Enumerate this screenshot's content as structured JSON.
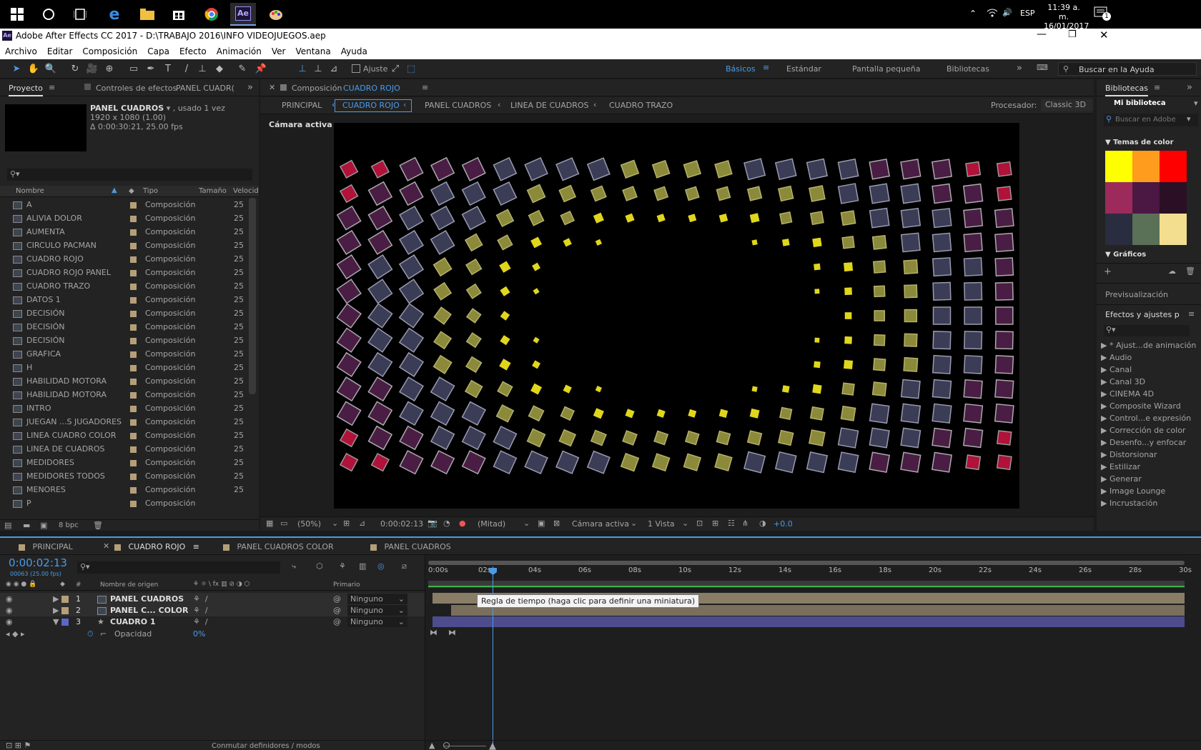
{
  "taskbar": {
    "time": "11:39 a. m.",
    "date": "16/01/2017",
    "lang": "ESP",
    "notif_count": "1",
    "ae_label": "Ae"
  },
  "window": {
    "title": "Adobe After Effects CC 2017 - D:\\TRABAJO 2016\\INFO VIDEOJUEGOS.aep",
    "icon": "Ae"
  },
  "menu": [
    "Archivo",
    "Editar",
    "Composición",
    "Capa",
    "Efecto",
    "Animación",
    "Ver",
    "Ventana",
    "Ayuda"
  ],
  "toolbar": {
    "ajuste": "Ajuste",
    "workspaces": [
      "Básicos",
      "Estándar",
      "Pantalla pequeña",
      "Bibliotecas"
    ],
    "search_placeholder": "Buscar en la Ayuda"
  },
  "project": {
    "tab": "Proyecto",
    "effects_tab": "Controles de efectos",
    "effects_target": "PANEL CUADR(",
    "selected_name": "PANEL CUADROS",
    "selected_used": ", usado 1 vez",
    "selected_res": "1920 x 1080 (1.00)",
    "selected_dur": "Δ 0:00:30:21, 25.00 fps",
    "columns": [
      "Nombre",
      "Tipo",
      "Tamaño",
      "Velocida"
    ],
    "bpc": "8 bpc",
    "items": [
      {
        "name": "A",
        "type": "Composición",
        "fps": "25"
      },
      {
        "name": "ALIVIA DOLOR",
        "type": "Composición",
        "fps": "25"
      },
      {
        "name": "AUMENTA",
        "type": "Composición",
        "fps": "25"
      },
      {
        "name": "CIRCULO PACMAN",
        "type": "Composición",
        "fps": "25"
      },
      {
        "name": "CUADRO ROJO",
        "type": "Composición",
        "fps": "25"
      },
      {
        "name": "CUADRO ROJO PANEL",
        "type": "Composición",
        "fps": "25"
      },
      {
        "name": "CUADRO TRAZO",
        "type": "Composición",
        "fps": "25"
      },
      {
        "name": "DATOS 1",
        "type": "Composición",
        "fps": "25"
      },
      {
        "name": "DECISIÓN",
        "type": "Composición",
        "fps": "25"
      },
      {
        "name": "DECISIÓN",
        "type": "Composición",
        "fps": "25"
      },
      {
        "name": "DECISIÓN",
        "type": "Composición",
        "fps": "25"
      },
      {
        "name": "GRAFICA",
        "type": "Composición",
        "fps": "25"
      },
      {
        "name": "H",
        "type": "Composición",
        "fps": "25"
      },
      {
        "name": "HABILIDAD MOTORA",
        "type": "Composición",
        "fps": "25"
      },
      {
        "name": "HABILIDAD MOTORA",
        "type": "Composición",
        "fps": "25"
      },
      {
        "name": "INTRO",
        "type": "Composición",
        "fps": "25"
      },
      {
        "name": "JUEGAN ...S JUGADORES",
        "type": "Composición",
        "fps": "25"
      },
      {
        "name": "LINEA CUADRO COLOR",
        "type": "Composición",
        "fps": "25"
      },
      {
        "name": "LINEA DE CUADROS",
        "type": "Composición",
        "fps": "25"
      },
      {
        "name": "MEDIDORES",
        "type": "Composición",
        "fps": "25"
      },
      {
        "name": "MEDIDORES TODOS",
        "type": "Composición",
        "fps": "25"
      },
      {
        "name": "MENORES",
        "type": "Composición",
        "fps": "25"
      },
      {
        "name": "P",
        "type": "Composición",
        "fps": ""
      }
    ]
  },
  "composition": {
    "tab_prefix": "Composición",
    "tab_name": "CUADRO ROJO",
    "breadcrumbs": [
      "PRINCIPAL",
      "CUADRO ROJO",
      "PANEL CUADROS",
      "LINEA DE CUADROS",
      "CUADRO TRAZO"
    ],
    "renderer_label": "Procesador:",
    "renderer": "Classic 3D",
    "camera_label": "Cámara activa",
    "zoom": "(50%)",
    "timecode": "0:00:02:13",
    "resolution": "(Mitad)",
    "camera": "Cámara activa",
    "views": "1 Vista",
    "exposure": "+0.0"
  },
  "libraries": {
    "tab": "Bibliotecas",
    "library": "Mi biblioteca",
    "search_placeholder": "Buscar en Adobe",
    "color_themes_label": "Temas de color",
    "colors": [
      [
        "#ffff00",
        "#ff9b1d",
        "#ff0000"
      ],
      [
        "#9c2b5b",
        "#4b1743",
        "#2a0f25"
      ],
      [
        "#2a2c3f",
        "#5a7057",
        "#f3de8f"
      ]
    ],
    "graphics_label": "Gráficos",
    "preview_tab": "Previsualización",
    "effects_tab": "Efectos y ajustes p",
    "effect_categories": [
      "* Ajust...de animación",
      "Audio",
      "Canal",
      "Canal 3D",
      "CINEMA 4D",
      "Composite Wizard",
      "Control...e expresión",
      "Corrección de color",
      "Desenfo...y enfocar",
      "Distorsionar",
      "Estilizar",
      "Generar",
      "Image Lounge",
      "Incrustación"
    ]
  },
  "timeline": {
    "tabs": [
      "PRINCIPAL",
      "CUADRO ROJO",
      "PANEL CUADROS COLOR",
      "PANEL CUADROS"
    ],
    "timecode": "0:00:02:13",
    "frame_info": "00063 (25.00 fps)",
    "col_hash": "#",
    "col_source": "Nombre de origen",
    "col_parent": "Primario",
    "ticks": [
      "0:00s",
      "02s",
      "04s",
      "06s",
      "08s",
      "10s",
      "12s",
      "14s",
      "16s",
      "18s",
      "20s",
      "22s",
      "24s",
      "26s",
      "28s",
      "30s"
    ],
    "layers": [
      {
        "num": "1",
        "name": "PANEL CUADROS",
        "parent": "Ninguno"
      },
      {
        "num": "2",
        "name": "PANEL C... COLOR",
        "parent": "Ninguno"
      },
      {
        "num": "3",
        "name": "CUADRO 1",
        "parent": "Ninguno"
      }
    ],
    "property": {
      "name": "Opacidad",
      "value": "0%"
    },
    "tooltip": "Regla de tiempo (haga clic para definir una miniatura)",
    "footer": "Conmutar definidores / modos"
  }
}
